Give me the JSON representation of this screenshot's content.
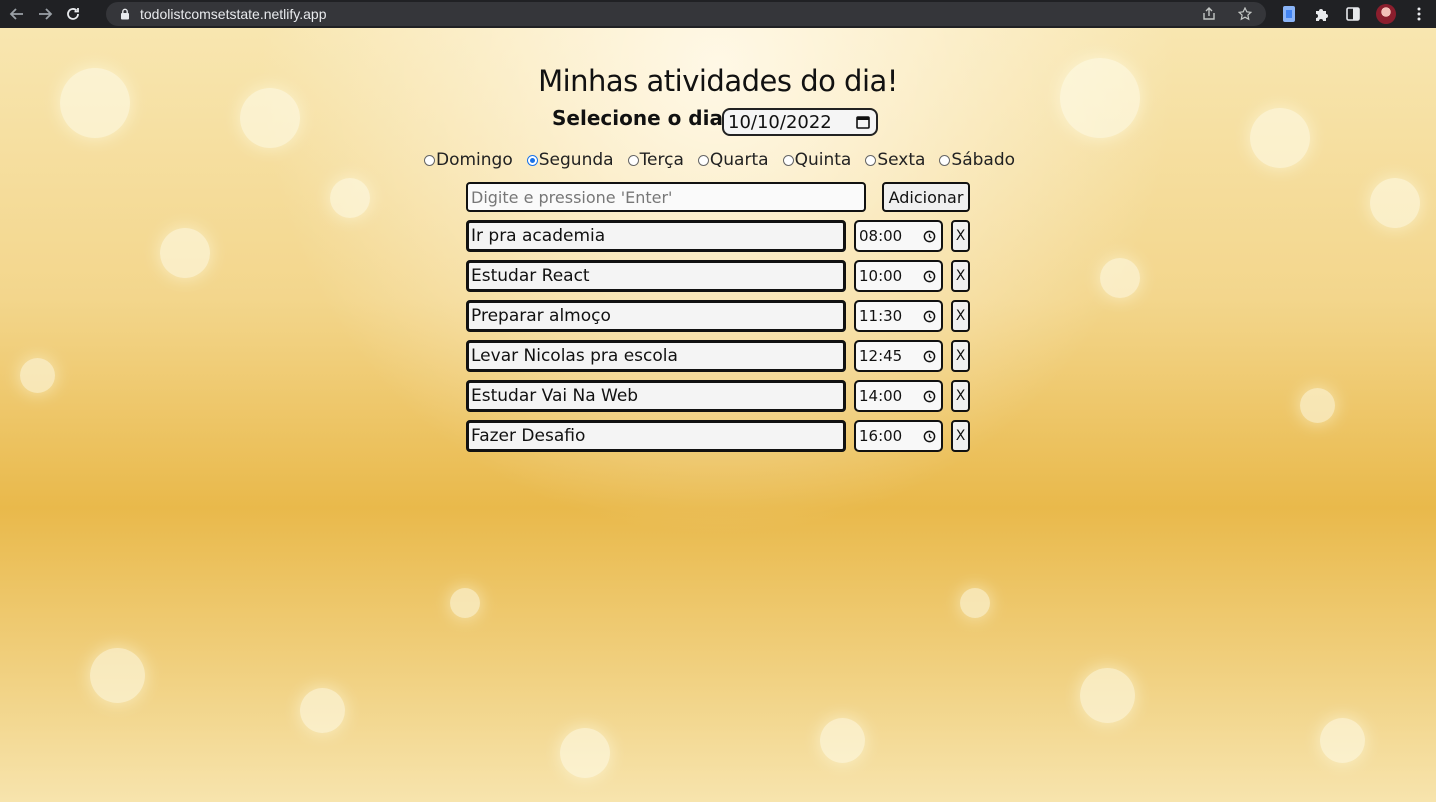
{
  "browser": {
    "url": "todolistcomsetstate.netlify.app",
    "back_icon": "back-arrow-icon",
    "forward_icon": "forward-arrow-icon",
    "reload_icon": "reload-icon"
  },
  "app": {
    "title": "Minhas atividades do dia!",
    "date_label": "Selecione o dia:",
    "date_value": "10/10/2022",
    "days": [
      {
        "label": "Domingo",
        "checked": false
      },
      {
        "label": "Segunda",
        "checked": true
      },
      {
        "label": "Terça",
        "checked": false
      },
      {
        "label": "Quarta",
        "checked": false
      },
      {
        "label": "Quinta",
        "checked": false
      },
      {
        "label": "Sexta",
        "checked": false
      },
      {
        "label": "Sábado",
        "checked": false
      }
    ],
    "new_task_placeholder": "Digite e pressione 'Enter'",
    "add_button": "Adicionar",
    "delete_label": "X",
    "tasks": [
      {
        "text": "Ir pra academia",
        "time": "08:00"
      },
      {
        "text": "Estudar React",
        "time": "10:00"
      },
      {
        "text": "Preparar almoço",
        "time": "11:30"
      },
      {
        "text": "Levar Nicolas pra escola",
        "time": "12:45"
      },
      {
        "text": "Estudar Vai Na Web",
        "time": "14:00"
      },
      {
        "text": "Fazer Desafio",
        "time": "16:00"
      }
    ]
  },
  "colors": {
    "accent_radio": "#1a73e8",
    "chrome_bg": "#202124",
    "background": "#f3d68c"
  }
}
